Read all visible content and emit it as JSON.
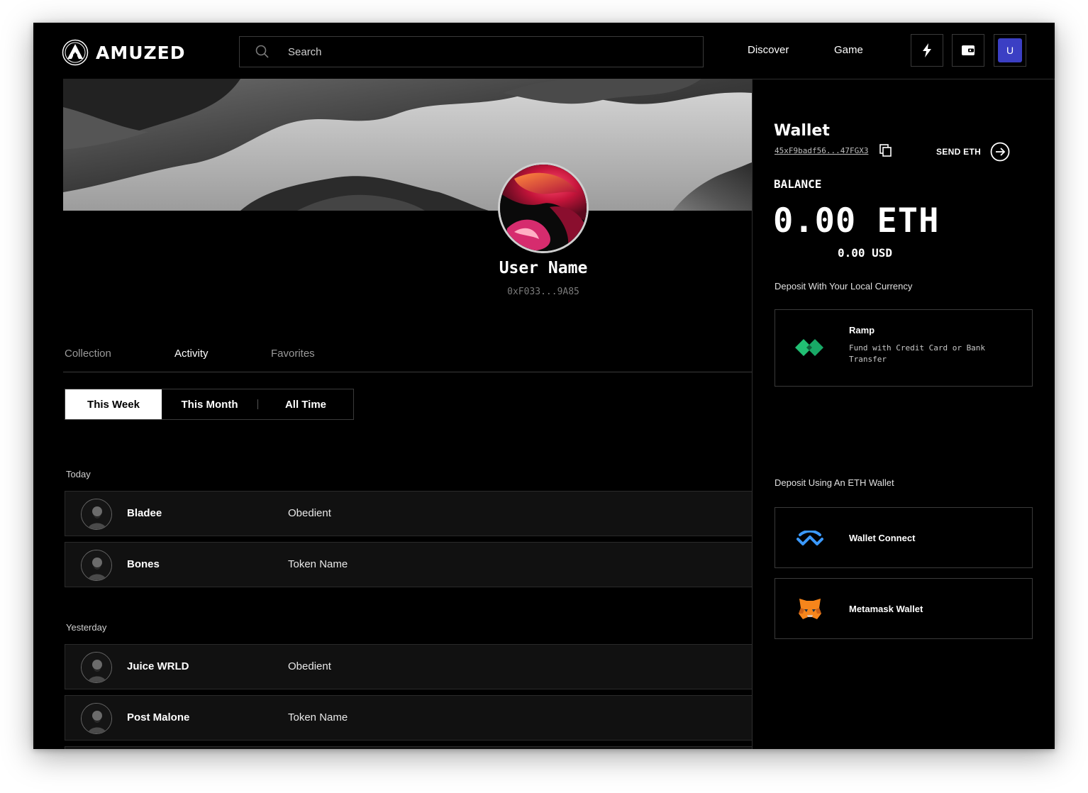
{
  "header": {
    "logo_text": "AMUZED",
    "search_placeholder": "Search",
    "nav": [
      "Discover",
      "Game"
    ],
    "user_initial": "U"
  },
  "profile": {
    "name": "User Name",
    "address": "0xF033...9A85"
  },
  "tabs": [
    "Collection",
    "Activity",
    "Favorites"
  ],
  "active_tab": "Activity",
  "period_filter": {
    "options": [
      "This Week",
      "This Month",
      "All Time"
    ],
    "selected": "This Week"
  },
  "activity": [
    {
      "label": "Today",
      "rows": [
        {
          "artist": "Bladee",
          "token": "Obedient"
        },
        {
          "artist": "Bones",
          "token": "Token Name"
        }
      ]
    },
    {
      "label": "Yesterday",
      "rows": [
        {
          "artist": "Juice WRLD",
          "token": "Obedient"
        },
        {
          "artist": "Post Malone",
          "token": "Token Name"
        }
      ]
    }
  ],
  "wallet": {
    "title": "Wallet",
    "address": "45xF9badf56...47FGX3",
    "send_label": "SEND ETH",
    "balance_label": "BALANCE",
    "balance_eth": "0.00 ETH",
    "balance_usd": "0.00 USD",
    "local_currency_label": "Deposit With Your Local Currency",
    "ramp": {
      "title": "Ramp",
      "description": "Fund with Credit Card or Bank Transfer"
    },
    "eth_wallet_label": "Deposit Using An ETH Wallet",
    "wallet_options": [
      "Wallet Connect",
      "Metamask Wallet"
    ]
  },
  "colors": {
    "background": "#000000",
    "accent_avatar": "#3b3fc4",
    "ramp_green": "#21bf73",
    "walletconnect_blue": "#3b99fc",
    "metamask_orange": "#e2761b"
  },
  "icons": [
    "search-icon",
    "lightning-icon",
    "wallet-icon",
    "copy-icon",
    "arrow-right-circle-icon",
    "ramp-icon",
    "walletconnect-icon",
    "metamask-icon"
  ]
}
